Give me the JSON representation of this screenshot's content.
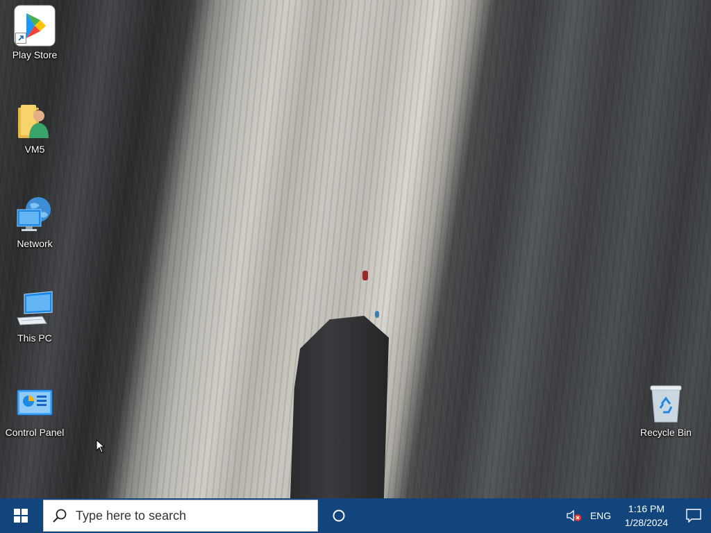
{
  "desktop": {
    "icons": [
      {
        "label": "Play Store",
        "icon": "play-store-icon"
      },
      {
        "label": "VM5",
        "icon": "user-folder-icon"
      },
      {
        "label": "Network",
        "icon": "network-icon"
      },
      {
        "label": "This PC",
        "icon": "this-pc-icon"
      },
      {
        "label": "Control Panel",
        "icon": "control-panel-icon"
      },
      {
        "label": "Recycle Bin",
        "icon": "recycle-bin-icon"
      }
    ]
  },
  "taskbar": {
    "start_icon": "windows-start-icon",
    "search": {
      "placeholder": "Type here to search",
      "icon": "search-icon"
    },
    "cortana_icon": "cortana-icon",
    "tray": {
      "volume_icon": "volume-muted-icon",
      "language": "ENG",
      "time": "1:16 PM",
      "date": "1/28/2024",
      "notification_icon": "action-center-icon"
    }
  },
  "colors": {
    "taskbar": "#13457d",
    "search_bg": "#ffffff"
  }
}
